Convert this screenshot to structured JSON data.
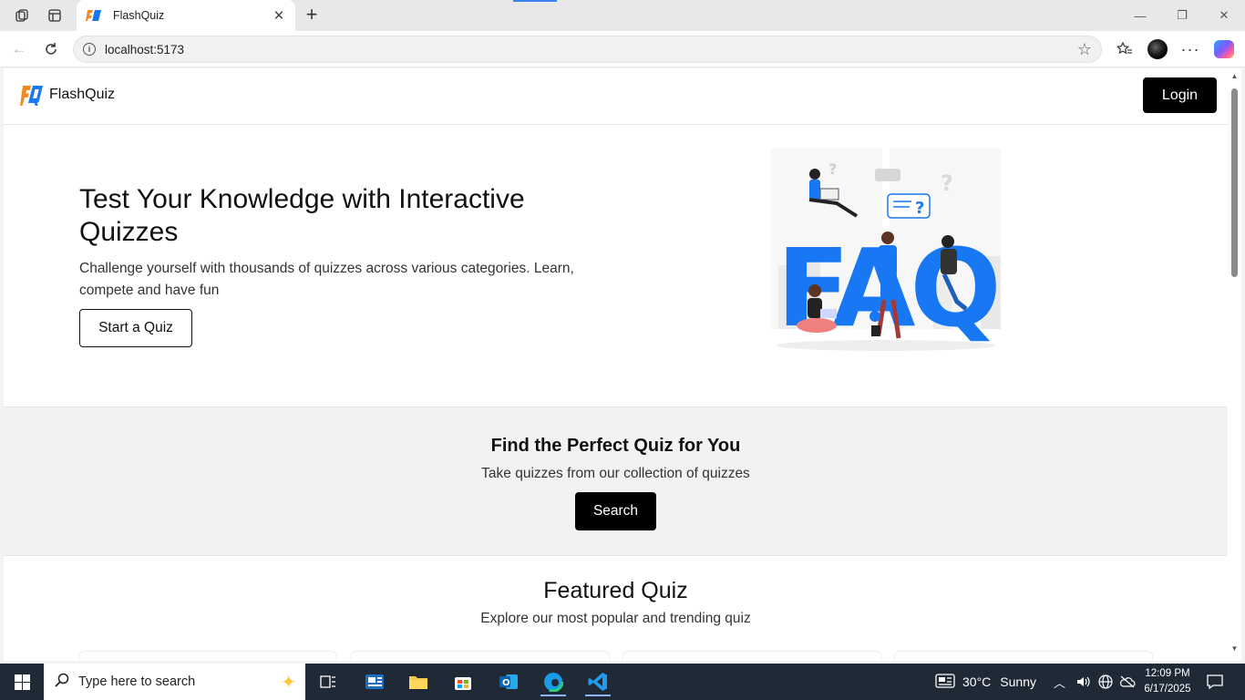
{
  "browser": {
    "tab_title": "FlashQuiz",
    "url": "localhost:5173"
  },
  "site": {
    "brand": "FlashQuiz",
    "login_label": "Login"
  },
  "hero": {
    "title": "Test Your Knowledge with Interactive Quizzes",
    "subtitle": "Challenge yourself with thousands of quizzes across various categories. Learn, compete and have fun",
    "cta_label": "Start a Quiz",
    "illustration_text": "FAQ"
  },
  "finder": {
    "title": "Find the Perfect Quiz for You",
    "subtitle": "Take quizzes from our collection of quizzes",
    "search_label": "Search"
  },
  "featured": {
    "title": "Featured Quiz",
    "subtitle": "Explore our most popular and trending quiz"
  },
  "taskbar": {
    "search_placeholder": "Type here to search",
    "weather_temp": "30°C",
    "weather_desc": "Sunny",
    "time": "12:09 PM",
    "date": "6/17/2025"
  },
  "colors": {
    "brand_blue": "#1877f2",
    "brand_orange": "#f08a24",
    "taskbar_bg": "#1f2a36"
  }
}
